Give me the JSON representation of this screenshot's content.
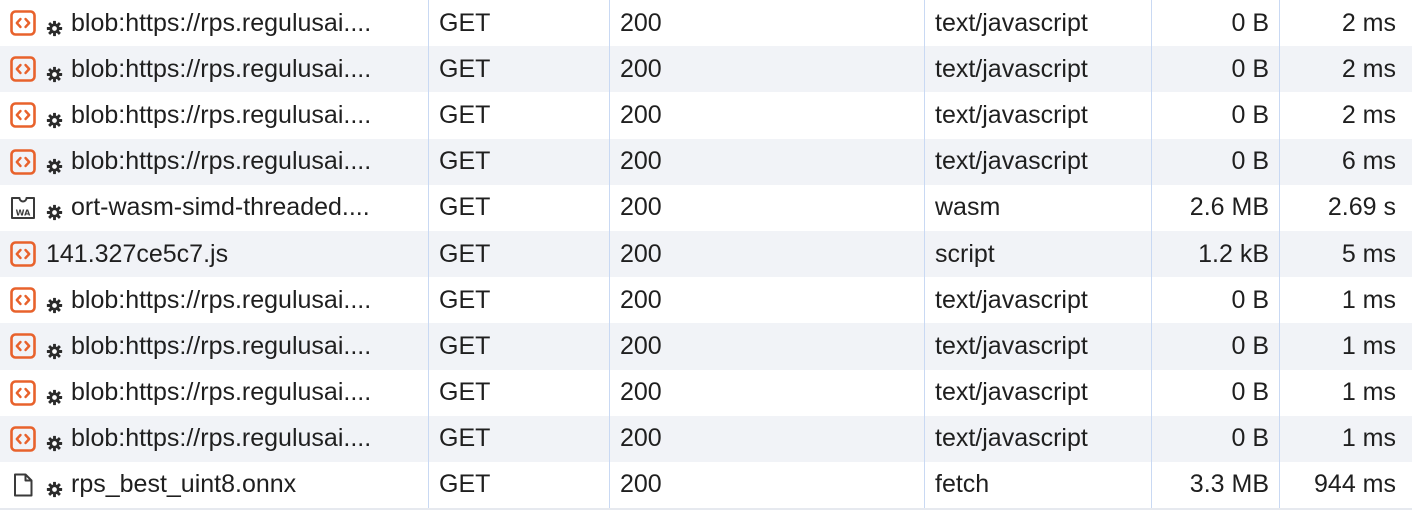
{
  "requests": [
    {
      "icon": "script-icon",
      "gear": true,
      "name": "blob:https://rps.regulusai....",
      "method": "GET",
      "status": "200",
      "type": "text/javascript",
      "size": "0 B",
      "time": "2 ms"
    },
    {
      "icon": "script-icon",
      "gear": true,
      "name": "blob:https://rps.regulusai....",
      "method": "GET",
      "status": "200",
      "type": "text/javascript",
      "size": "0 B",
      "time": "2 ms"
    },
    {
      "icon": "script-icon",
      "gear": true,
      "name": "blob:https://rps.regulusai....",
      "method": "GET",
      "status": "200",
      "type": "text/javascript",
      "size": "0 B",
      "time": "2 ms"
    },
    {
      "icon": "script-icon",
      "gear": true,
      "name": "blob:https://rps.regulusai....",
      "method": "GET",
      "status": "200",
      "type": "text/javascript",
      "size": "0 B",
      "time": "6 ms"
    },
    {
      "icon": "wasm-icon",
      "gear": true,
      "name": "ort-wasm-simd-threaded....",
      "method": "GET",
      "status": "200",
      "type": "wasm",
      "size": "2.6 MB",
      "time": "2.69 s"
    },
    {
      "icon": "script-icon",
      "gear": false,
      "name": "141.327ce5c7.js",
      "method": "GET",
      "status": "200",
      "type": "script",
      "size": "1.2 kB",
      "time": "5 ms"
    },
    {
      "icon": "script-icon",
      "gear": true,
      "name": "blob:https://rps.regulusai....",
      "method": "GET",
      "status": "200",
      "type": "text/javascript",
      "size": "0 B",
      "time": "1 ms"
    },
    {
      "icon": "script-icon",
      "gear": true,
      "name": "blob:https://rps.regulusai....",
      "method": "GET",
      "status": "200",
      "type": "text/javascript",
      "size": "0 B",
      "time": "1 ms"
    },
    {
      "icon": "script-icon",
      "gear": true,
      "name": "blob:https://rps.regulusai....",
      "method": "GET",
      "status": "200",
      "type": "text/javascript",
      "size": "0 B",
      "time": "1 ms"
    },
    {
      "icon": "script-icon",
      "gear": true,
      "name": "blob:https://rps.regulusai....",
      "method": "GET",
      "status": "200",
      "type": "text/javascript",
      "size": "0 B",
      "time": "1 ms"
    },
    {
      "icon": "document-icon",
      "gear": true,
      "name": "rps_best_uint8.onnx",
      "method": "GET",
      "status": "200",
      "type": "fetch",
      "size": "3.3 MB",
      "time": "944 ms"
    }
  ],
  "colors": {
    "script_icon": "#e8622c",
    "row_alt": "#f1f3f7",
    "column_divider": "#c9d9f3"
  }
}
